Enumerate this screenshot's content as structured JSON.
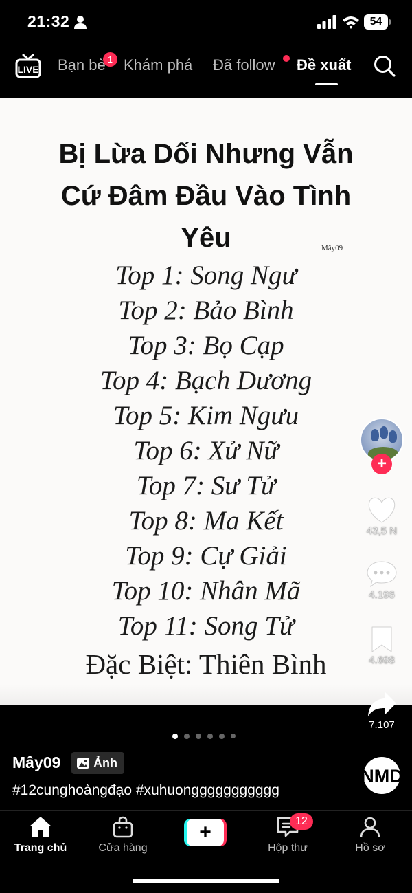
{
  "status_bar": {
    "time": "21:32",
    "battery": "54"
  },
  "top_nav": {
    "live_label": "LIVE",
    "tabs": [
      {
        "label": "Bạn bè",
        "badge": "1"
      },
      {
        "label": "Khám phá"
      },
      {
        "label": "Đã follow"
      },
      {
        "label": "Đề xuất",
        "active": true
      }
    ]
  },
  "post": {
    "title_lines": [
      "Bị Lừa Dối Nhưng Vẫn",
      "Cứ Đâm Đầu Vào Tình",
      "Yêu"
    ],
    "watermark": "Mây09",
    "ranking": [
      "Top 1: Song Ngư",
      "Top 2: Bảo Bình",
      "Top 3: Bọ Cạp",
      "Top 4: Bạch Dương",
      "Top 5: Kim Ngưu",
      "Top 6: Xử Nữ",
      "Top 7: Sư Tử",
      "Top 8: Ma Kết",
      "Top 9: Cự Giải",
      "Top 10: Nhân Mã",
      "Top 11: Song Tử"
    ],
    "special": "Đặc Biệt: Thiên Bình",
    "carousel": {
      "pages": 6,
      "current": 1
    }
  },
  "actions": {
    "likes": "43,5 N",
    "comments": "4.196",
    "saves": "4.698",
    "shares": "7.107"
  },
  "info": {
    "author": "Mây09",
    "type_tag": "Ảnh",
    "hashtags": "#12cunghoàngđạo #xuhuonggggggggggg"
  },
  "tabbar": {
    "home": "Trang chủ",
    "shop": "Cửa hàng",
    "create": "+",
    "inbox": "Hộp thư",
    "inbox_badge": "12",
    "profile": "Hồ sơ"
  },
  "colors": {
    "accent": "#fe2c55",
    "cyan": "#25f4ee",
    "background": "#000000",
    "card": "#fbfaf9"
  }
}
